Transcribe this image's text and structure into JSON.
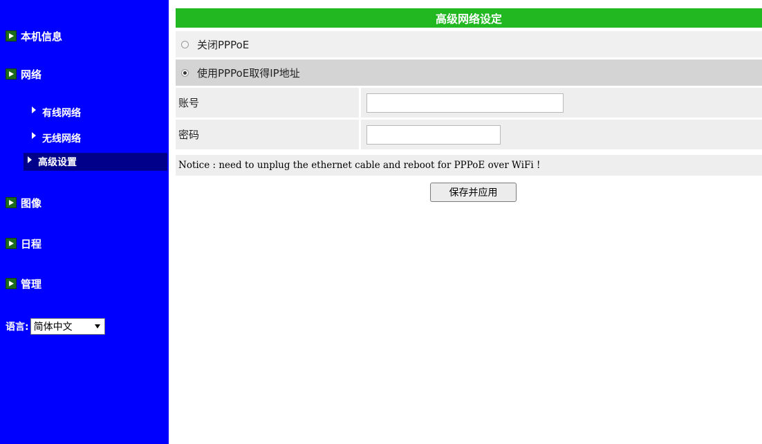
{
  "sidebar": {
    "menu": [
      {
        "label": "本机信息"
      },
      {
        "label": "网络"
      },
      {
        "label": "图像"
      },
      {
        "label": "日程"
      },
      {
        "label": "管理"
      }
    ],
    "submenu": [
      {
        "label": "有线网络"
      },
      {
        "label": "无线网络"
      },
      {
        "label": "高级设置"
      }
    ],
    "language": {
      "label": "语言:",
      "selected": "简体中文"
    }
  },
  "main": {
    "title": "高级网络设定",
    "options": {
      "off": "关闭PPPoE",
      "use": "使用PPPoE取得IP地址"
    },
    "fields": {
      "account": "账号",
      "password": "密码"
    },
    "notice": "Notice : need to unplug the ethernet cable and reboot for PPPoE over WiFi !",
    "save_button": "保存并应用"
  },
  "colors": {
    "sidebar": "#0000ff",
    "title_bar": "#22b822",
    "active_item": "#00008b"
  }
}
